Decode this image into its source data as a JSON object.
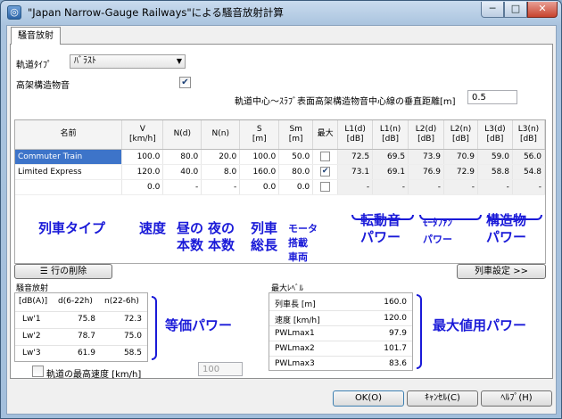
{
  "window": {
    "title": "\"Japan Narrow-Gauge Railways\"による騒音放射計算",
    "min": "─",
    "max": "□",
    "close": "✕"
  },
  "tab": {
    "label": "騒音放射"
  },
  "track": {
    "label": "軌道ﾀｲﾌﾟ",
    "value": "ﾊﾞﾗｽﾄ"
  },
  "elevated": {
    "label": "高架構造物音",
    "checked": true
  },
  "vdist": {
    "label": "軌道中心～ｽﾗﾌﾞ表面高架構造物音中心線の垂直距離[m]",
    "value": "0.5"
  },
  "grid": {
    "headers": [
      "名前",
      "V\n[km/h]",
      "N(d)",
      "N(n)",
      "S\n[m]",
      "Sm\n[m]",
      "最大",
      "L1(d)\n[dB]",
      "L1(n)\n[dB]",
      "L2(d)\n[dB]",
      "L2(n)\n[dB]",
      "L3(d)\n[dB]",
      "L3(n)\n[dB]"
    ],
    "rows": [
      {
        "name": "Commuter Train",
        "v": "100.0",
        "nd": "80.0",
        "nn": "20.0",
        "s": "100.0",
        "sm": "50.0",
        "max": false,
        "l1d": "72.5",
        "l1n": "69.5",
        "l2d": "73.9",
        "l2n": "70.9",
        "l3d": "59.0",
        "l3n": "56.0"
      },
      {
        "name": "Limited Express",
        "v": "120.0",
        "nd": "40.0",
        "nn": "8.0",
        "s": "160.0",
        "sm": "80.0",
        "max": true,
        "l1d": "73.1",
        "l1n": "69.1",
        "l2d": "76.9",
        "l2n": "72.9",
        "l3d": "58.8",
        "l3n": "54.8"
      },
      {
        "name": "",
        "v": "0.0",
        "nd": "-",
        "nn": "-",
        "s": "0.0",
        "sm": "0.0",
        "max": false,
        "l1d": "-",
        "l1n": "-",
        "l2d": "-",
        "l2n": "-",
        "l3d": "-",
        "l3n": "-"
      }
    ]
  },
  "annotations": {
    "train_type": "列車タイプ",
    "speed": "速度",
    "day_count": "昼の\n本数",
    "night_count": "夜の\n本数",
    "train_length": "列車\n総長",
    "motor_length": "モータ\n搭載\n車両\n総長",
    "rolling": "転動音\nパワー",
    "motorfan": "ﾓｰﾀﾌｧﾝ\nパワー",
    "structure": "構造物\nパワー",
    "equiv": "等価パワー",
    "maxpower": "最大値用パワー"
  },
  "buttons": {
    "delete_row": "行の削除",
    "train_settings": "列車設定 >>",
    "ok": "OK(O)",
    "cancel": "ｷｬﾝｾﾙ(C)",
    "help": "ﾍﾙﾌﾟ(H)"
  },
  "emission": {
    "title": "騒音放射",
    "headers": [
      "[dB(A)]",
      "d(6-22h)",
      "n(22-6h)"
    ],
    "rows": [
      {
        "label": "Lw'1",
        "d": "75.8",
        "n": "72.3"
      },
      {
        "label": "Lw'2",
        "d": "78.7",
        "n": "75.0"
      },
      {
        "label": "Lw'3",
        "d": "61.9",
        "n": "58.5"
      }
    ]
  },
  "maxlevel": {
    "title": "最大ﾚﾍﾞﾙ",
    "rows": [
      {
        "label": "列車長 [m]",
        "value": "160.0"
      },
      {
        "label": "速度 [km/h]",
        "value": "120.0"
      },
      {
        "label": "PWLmax1",
        "value": "97.9"
      },
      {
        "label": "PWLmax2",
        "value": "101.7"
      },
      {
        "label": "PWLmax3",
        "value": "83.6"
      }
    ]
  },
  "maxspeed": {
    "label": "軌道の最高速度 [km/h]",
    "checked": false,
    "value": "100"
  }
}
